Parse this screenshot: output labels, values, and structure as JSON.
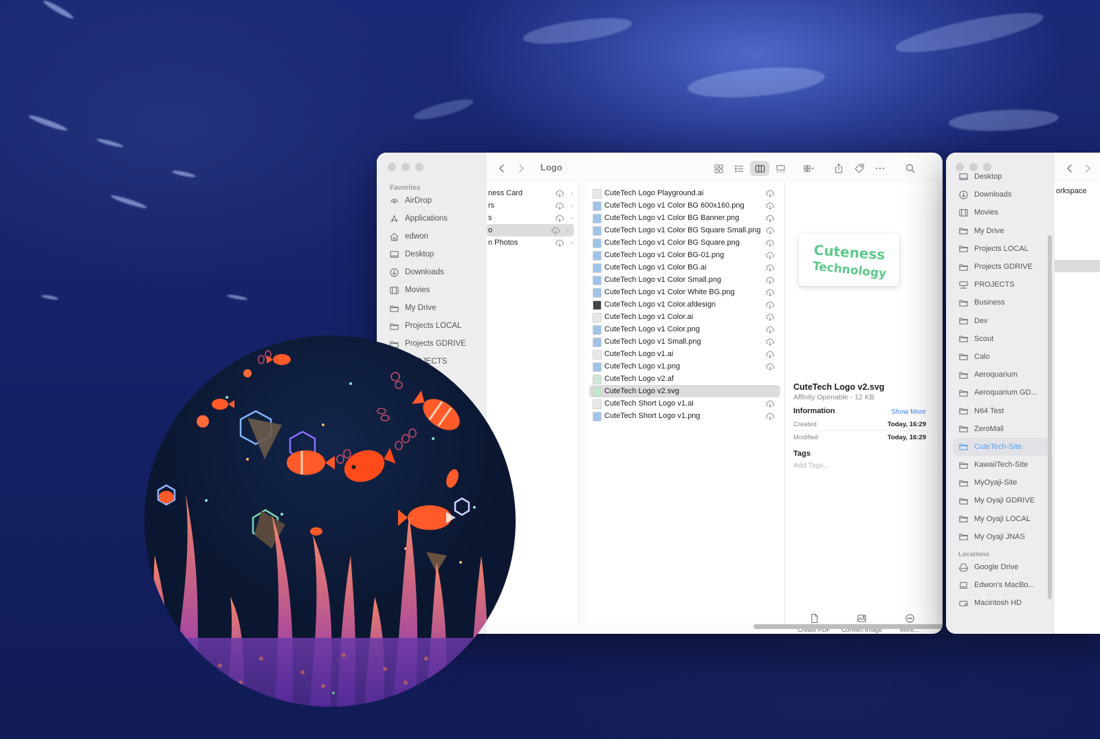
{
  "finder_main": {
    "path_title": "Logo",
    "sidebar": {
      "section": "Favorites",
      "items": [
        {
          "label": "AirDrop",
          "icon": "airdrop-icon"
        },
        {
          "label": "Applications",
          "icon": "applications-icon"
        },
        {
          "label": "edwon",
          "icon": "home-icon"
        },
        {
          "label": "Desktop",
          "icon": "desktop-icon"
        },
        {
          "label": "Downloads",
          "icon": "downloads-icon"
        },
        {
          "label": "Movies",
          "icon": "movies-icon"
        },
        {
          "label": "My Drive",
          "icon": "folder-icon"
        },
        {
          "label": "Projects LOCAL",
          "icon": "folder-icon"
        },
        {
          "label": "Projects GDRIVE",
          "icon": "folder-icon"
        },
        {
          "label": "PROJECTS",
          "icon": "network-drive-icon"
        }
      ]
    },
    "parent_column": [
      {
        "label": "ness Card",
        "selected": false
      },
      {
        "label": "rs",
        "selected": false
      },
      {
        "label": "s",
        "selected": false
      },
      {
        "label": "o",
        "selected": true
      },
      {
        "label": "n Photos",
        "selected": false
      }
    ],
    "files": [
      {
        "name": "CuteTech Logo Playground.ai",
        "cloud": true,
        "selected": false,
        "icon": "ai-file-icon"
      },
      {
        "name": "CuteTech Logo v1 Color BG 600x160.png",
        "cloud": true,
        "selected": false,
        "icon": "png-file-icon"
      },
      {
        "name": "CuteTech Logo v1 Color BG Banner.png",
        "cloud": true,
        "selected": false,
        "icon": "png-file-icon"
      },
      {
        "name": "CuteTech Logo v1 Color BG Square Small.png",
        "cloud": true,
        "selected": false,
        "icon": "png-file-icon"
      },
      {
        "name": "CuteTech Logo v1 Color BG Square.png",
        "cloud": true,
        "selected": false,
        "icon": "png-file-icon"
      },
      {
        "name": "CuteTech Logo v1 Color BG-01.png",
        "cloud": true,
        "selected": false,
        "icon": "png-file-icon"
      },
      {
        "name": "CuteTech Logo v1 Color BG.ai",
        "cloud": true,
        "selected": false,
        "icon": "png-file-icon"
      },
      {
        "name": "CuteTech Logo v1 Color Small.png",
        "cloud": true,
        "selected": false,
        "icon": "png-file-icon"
      },
      {
        "name": "CuteTech Logo v1 Color White BG.png",
        "cloud": true,
        "selected": false,
        "icon": "png-file-icon"
      },
      {
        "name": "CuteTech Logo v1 Color.afdesign",
        "cloud": true,
        "selected": false,
        "icon": "afdesign-file-icon"
      },
      {
        "name": "CuteTech Logo v1 Color.ai",
        "cloud": true,
        "selected": false,
        "icon": "ai-file-icon"
      },
      {
        "name": "CuteTech Logo v1 Color.png",
        "cloud": true,
        "selected": false,
        "icon": "png-file-icon"
      },
      {
        "name": "CuteTech Logo v1 Small.png",
        "cloud": true,
        "selected": false,
        "icon": "png-file-icon"
      },
      {
        "name": "CuteTech Logo v1.ai",
        "cloud": true,
        "selected": false,
        "icon": "ai-file-icon"
      },
      {
        "name": "CuteTech Logo v1.png",
        "cloud": true,
        "selected": false,
        "icon": "png-file-icon"
      },
      {
        "name": "CuteTech Logo v2.af",
        "cloud": false,
        "selected": false,
        "icon": "af-file-icon"
      },
      {
        "name": "CuteTech Logo v2.svg",
        "cloud": false,
        "selected": true,
        "icon": "svg-file-icon"
      },
      {
        "name": "CuteTech Short Logo v1.ai",
        "cloud": true,
        "selected": false,
        "icon": "ai-file-icon"
      },
      {
        "name": "CuteTech Short Logo v1.png",
        "cloud": true,
        "selected": false,
        "icon": "png-file-icon"
      }
    ],
    "preview": {
      "logo_line1": "Cuteness",
      "logo_line2": "Technology",
      "logo_color": "#5cc98a",
      "file_name": "CuteTech Logo v2.svg",
      "kind": "Affinity Openable - 12 KB",
      "info_heading": "Information",
      "show_more": "Show More",
      "created_label": "Created",
      "created_value": "Today, 16:29",
      "modified_label": "Modified",
      "modified_value": "Today, 16:29",
      "tags_heading": "Tags",
      "tags_placeholder": "Add Tags...",
      "actions": [
        {
          "label": "Create PDF",
          "icon": "document-icon"
        },
        {
          "label": "Convert Image",
          "icon": "image-icon"
        },
        {
          "label": "More...",
          "icon": "ellipsis-circle-icon"
        }
      ]
    }
  },
  "finder_second": {
    "sidebar_items": [
      {
        "label": "Desktop",
        "icon": "desktop-icon"
      },
      {
        "label": "Downloads",
        "icon": "downloads-icon"
      },
      {
        "label": "Movies",
        "icon": "movies-icon"
      },
      {
        "label": "My Drive",
        "icon": "folder-icon"
      },
      {
        "label": "Projects LOCAL",
        "icon": "folder-icon"
      },
      {
        "label": "Projects GDRIVE",
        "icon": "folder-icon"
      },
      {
        "label": "PROJECTS",
        "icon": "network-drive-icon"
      },
      {
        "label": "Business",
        "icon": "folder-icon"
      },
      {
        "label": "Dev",
        "icon": "folder-icon"
      },
      {
        "label": "Scout",
        "icon": "folder-icon"
      },
      {
        "label": "Calo",
        "icon": "folder-icon"
      },
      {
        "label": "Aeroquarium",
        "icon": "folder-icon"
      },
      {
        "label": "Aeroquarium GD...",
        "icon": "folder-icon"
      },
      {
        "label": "N64 Test",
        "icon": "folder-icon"
      },
      {
        "label": "ZeroMail",
        "icon": "folder-icon"
      },
      {
        "label": "CuteTech-Site",
        "icon": "folder-icon",
        "selected": true
      },
      {
        "label": "KawaiiTech-Site",
        "icon": "folder-icon"
      },
      {
        "label": "MyOyaji-Site",
        "icon": "folder-icon"
      },
      {
        "label": "My Oyaji GDRIVE",
        "icon": "folder-icon"
      },
      {
        "label": "My Oyaji LOCAL",
        "icon": "folder-icon"
      },
      {
        "label": "My Oyaji JNAS",
        "icon": "folder-icon"
      }
    ],
    "locations_section": "Locations",
    "locations": [
      {
        "label": "Google Drive",
        "icon": "google-drive-icon"
      },
      {
        "label": "Edwon's MacBo...",
        "icon": "laptop-icon"
      },
      {
        "label": "Macintosh HD",
        "icon": "disk-icon"
      }
    ],
    "column_fragment": "orkspace"
  }
}
